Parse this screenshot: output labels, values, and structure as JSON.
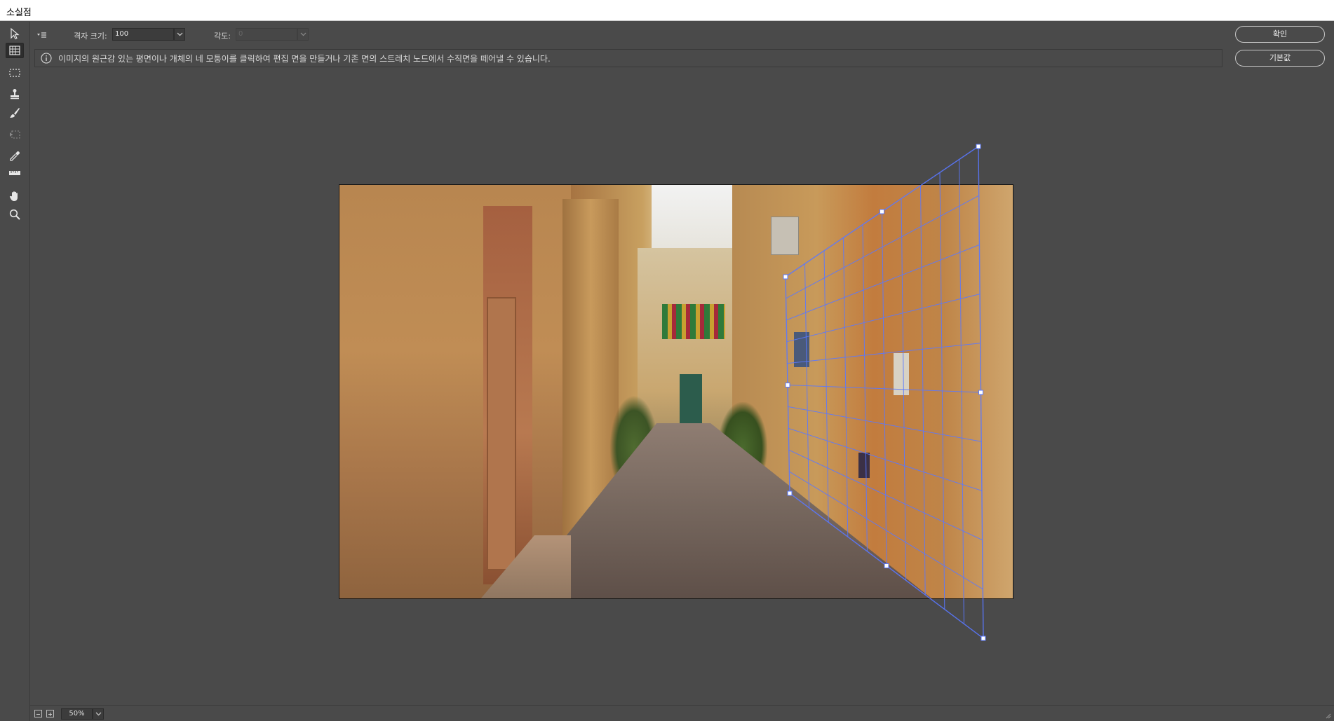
{
  "window": {
    "title": "소실점"
  },
  "toolbar": {
    "tools": [
      {
        "name": "edit-plane-tool-icon",
        "active": false
      },
      {
        "name": "create-plane-tool-icon",
        "active": true
      },
      {
        "name": "marquee-tool-icon",
        "active": false
      },
      {
        "name": "stamp-tool-icon",
        "active": false
      },
      {
        "name": "brush-tool-icon",
        "active": false
      },
      {
        "name": "transform-tool-icon",
        "active": false
      },
      {
        "name": "eyedropper-tool-icon",
        "active": false
      },
      {
        "name": "measure-tool-icon",
        "active": false
      },
      {
        "name": "hand-tool-icon",
        "active": false
      },
      {
        "name": "zoom-tool-icon",
        "active": false
      }
    ]
  },
  "options": {
    "grid_size_label": "격자 크기:",
    "grid_size_value": "100",
    "angle_label": "각도:",
    "angle_value": "0"
  },
  "info": {
    "message": "이미지의 원근감 있는 평면이나 개체의 네 모퉁이를 클릭하여 편집 면을 만들거나 기존 면의 스트레치 노드에서 수직면을 떼어낼 수 있습니다."
  },
  "buttons": {
    "ok": "확인",
    "reset": "기본값"
  },
  "status": {
    "zoom": "50%"
  },
  "colors": {
    "grid": "#5a78ff",
    "background": "#4a4a4a"
  }
}
